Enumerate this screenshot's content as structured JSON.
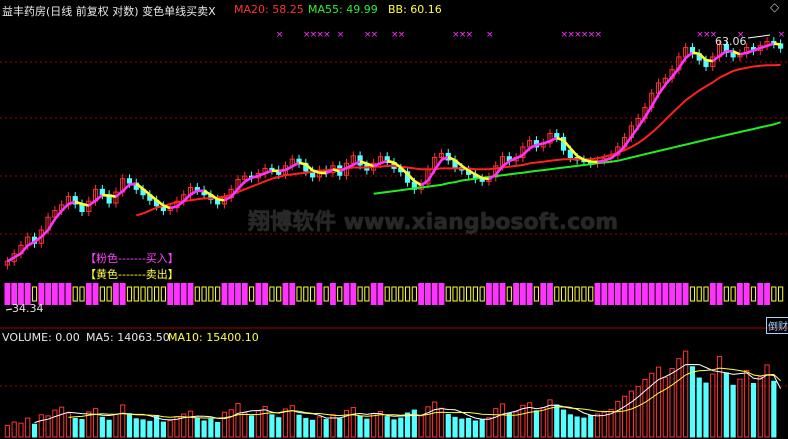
{
  "header": {
    "title": "益丰药房(日线 前复权 对数) 变色单线买卖X",
    "ma20_label": "MA20: 58.25",
    "ma55_label": "MA55: 49.99",
    "bb_label": "BB: 60.16"
  },
  "volume_header": {
    "volume_label": "VOLUME: 0.00",
    "ma5_label": "MA5: 14063.50",
    "ma10_label": "MA10: 15400.10"
  },
  "legend": {
    "pink_buy": "【粉色-------买入】",
    "yellow_sell": "【黄色-------卖出】"
  },
  "annotations": {
    "high": "63.06",
    "low": "34.34",
    "corner": "倒财"
  },
  "watermark": "翔博软件 www.xiangbosoft.com",
  "colors": {
    "background": "#000000",
    "up": "#ff3232",
    "down": "#54ffff",
    "ma20": "#ff2020",
    "ma55": "#20ee20",
    "bb_pink": "#ff33ff",
    "bb_yellow": "#ffff33",
    "blue_line": "#2a5cff",
    "grid": "#b00000"
  },
  "chart_data": {
    "type": "candlestick",
    "title": "益丰药房(日线 前复权 对数) 变色单线买卖X",
    "y_scale": "log",
    "price_ylim": [
      33,
      66
    ],
    "close": [
      34.5,
      35.2,
      36.0,
      36.8,
      36.2,
      37.5,
      38.8,
      39.5,
      40.1,
      41.0,
      40.2,
      39.4,
      40.5,
      41.8,
      41.2,
      40.3,
      41.5,
      43.0,
      42.5,
      41.8,
      41.2,
      40.6,
      40.0,
      39.5,
      39.8,
      40.5,
      41.2,
      42.0,
      41.7,
      41.2,
      40.7,
      40.2,
      40.9,
      41.8,
      42.9,
      43.3,
      43.1,
      43.6,
      44.2,
      44.0,
      43.5,
      44.5,
      45.3,
      44.8,
      43.9,
      43.2,
      44.0,
      43.7,
      44.5,
      43.4,
      44.8,
      45.7,
      44.6,
      44.0,
      44.8,
      45.6,
      44.9,
      44.2,
      43.8,
      42.6,
      41.8,
      42.4,
      44.1,
      45.5,
      46.0,
      45.2,
      44.3,
      44.0,
      43.5,
      43.0,
      42.7,
      43.2,
      44.5,
      45.6,
      45.1,
      45.5,
      46.8,
      47.6,
      46.8,
      47.3,
      48.5,
      48.0,
      46.4,
      45.5,
      45.2,
      45.0,
      44.8,
      45.1,
      45.4,
      45.8,
      46.8,
      48.0,
      49.5,
      50.5,
      52.0,
      54.0,
      55.5,
      56.2,
      57.5,
      59.5,
      61.0,
      60.0,
      59.0,
      58.0,
      59.5,
      61.5,
      60.2,
      59.5,
      60.0,
      61.0,
      60.5,
      61.3,
      62.0,
      61.6,
      60.9
    ],
    "ma20": [
      null,
      null,
      null,
      null,
      null,
      null,
      null,
      null,
      null,
      null,
      null,
      null,
      null,
      null,
      null,
      null,
      null,
      null,
      null,
      39.0,
      39.2,
      39.5,
      39.8,
      40.0,
      40.2,
      40.4,
      40.5,
      40.6,
      40.7,
      40.8,
      40.8,
      40.9,
      41.0,
      41.2,
      41.5,
      41.8,
      42.1,
      42.4,
      42.7,
      43.0,
      43.2,
      43.4,
      43.5,
      43.6,
      43.7,
      43.8,
      43.9,
      44.0,
      44.1,
      44.1,
      44.2,
      44.3,
      44.3,
      44.3,
      44.4,
      44.4,
      44.5,
      44.5,
      44.4,
      44.3,
      44.2,
      44.1,
      44.1,
      44.1,
      44.2,
      44.2,
      44.2,
      44.2,
      44.2,
      44.1,
      44.1,
      44.1,
      44.2,
      44.3,
      44.4,
      44.5,
      44.6,
      44.8,
      44.9,
      45.0,
      45.1,
      45.2,
      45.3,
      45.3,
      45.3,
      45.3,
      45.3,
      45.4,
      45.6,
      45.8,
      46.1,
      46.4,
      46.8,
      47.3,
      47.9,
      48.6,
      49.4,
      50.3,
      51.2,
      52.1,
      53.0,
      53.7,
      54.4,
      55.0,
      55.6,
      56.3,
      56.8,
      57.3,
      57.6,
      57.8,
      58.0,
      58.1,
      58.2,
      58.2,
      58.25
    ],
    "ma55": [
      null,
      null,
      null,
      null,
      null,
      null,
      null,
      null,
      null,
      null,
      null,
      null,
      null,
      null,
      null,
      null,
      null,
      null,
      null,
      null,
      null,
      null,
      null,
      null,
      null,
      null,
      null,
      null,
      null,
      null,
      null,
      null,
      null,
      null,
      null,
      null,
      null,
      null,
      null,
      null,
      null,
      null,
      null,
      null,
      null,
      null,
      null,
      null,
      null,
      null,
      null,
      null,
      null,
      null,
      41.3,
      41.4,
      41.5,
      41.6,
      41.7,
      41.8,
      41.9,
      42.0,
      42.1,
      42.2,
      42.3,
      42.5,
      42.6,
      42.8,
      42.9,
      43.0,
      43.1,
      43.2,
      43.3,
      43.4,
      43.5,
      43.6,
      43.7,
      43.8,
      43.9,
      44.0,
      44.1,
      44.2,
      44.3,
      44.4,
      44.5,
      44.6,
      44.7,
      44.8,
      44.9,
      45.0,
      45.1,
      45.3,
      45.5,
      45.7,
      45.9,
      46.1,
      46.3,
      46.5,
      46.7,
      46.9,
      47.1,
      47.3,
      47.5,
      47.7,
      47.9,
      48.1,
      48.3,
      48.5,
      48.7,
      48.9,
      49.1,
      49.3,
      49.5,
      49.7,
      49.99
    ],
    "signal_high_close": 63.06,
    "signal_low_close": 34.34,
    "volume": [
      3200,
      4100,
      3800,
      5200,
      3500,
      6100,
      5800,
      7400,
      8200,
      6600,
      5100,
      4800,
      6900,
      7800,
      5400,
      4600,
      6200,
      8800,
      6400,
      5000,
      4700,
      4300,
      5900,
      4100,
      4500,
      5600,
      6300,
      7100,
      5200,
      4400,
      4900,
      4000,
      6800,
      7500,
      9200,
      6700,
      5800,
      7200,
      8400,
      6100,
      5300,
      7700,
      8600,
      6000,
      5100,
      4600,
      5500,
      4800,
      6200,
      5000,
      7300,
      8100,
      5700,
      4900,
      6400,
      7000,
      5600,
      4700,
      5200,
      6600,
      7400,
      5800,
      8300,
      9600,
      7900,
      6200,
      5400,
      4900,
      5100,
      4400,
      4700,
      5300,
      7800,
      9100,
      6500,
      6900,
      8700,
      9400,
      7200,
      8100,
      10200,
      8800,
      7400,
      6100,
      5500,
      5200,
      5900,
      6300,
      6800,
      7600,
      9800,
      11200,
      12600,
      13900,
      15800,
      17500,
      19200,
      16400,
      18800,
      21500,
      23600,
      19300,
      16200,
      14800,
      17300,
      22100,
      17600,
      14200,
      15900,
      18300,
      14700,
      16500,
      19800,
      15300,
      0
    ]
  }
}
